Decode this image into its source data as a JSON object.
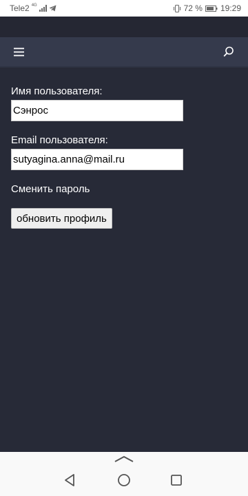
{
  "status_bar": {
    "carrier": "Tele2",
    "network": "4G",
    "battery_percent": "72 %",
    "time": "19:29"
  },
  "app_bar": {
    "menu_icon": "hamburger-menu-icon",
    "search_icon": "search-icon"
  },
  "form": {
    "username_label": "Имя пользователя:",
    "username_value": "Сэнрос",
    "email_label": "Email пользователя:",
    "email_value": "sutyagina.anna@mail.ru",
    "change_password_link": "Сменить пароль",
    "update_button": "обновить профиль"
  },
  "nav_bar": {
    "handle_icon": "chevron-up-icon",
    "back_icon": "back-triangle-icon",
    "home_icon": "home-circle-icon",
    "recent_icon": "recent-apps-square-icon"
  },
  "colors": {
    "background": "#272a37",
    "app_bar": "#353a4c",
    "text": "#ffffff"
  }
}
